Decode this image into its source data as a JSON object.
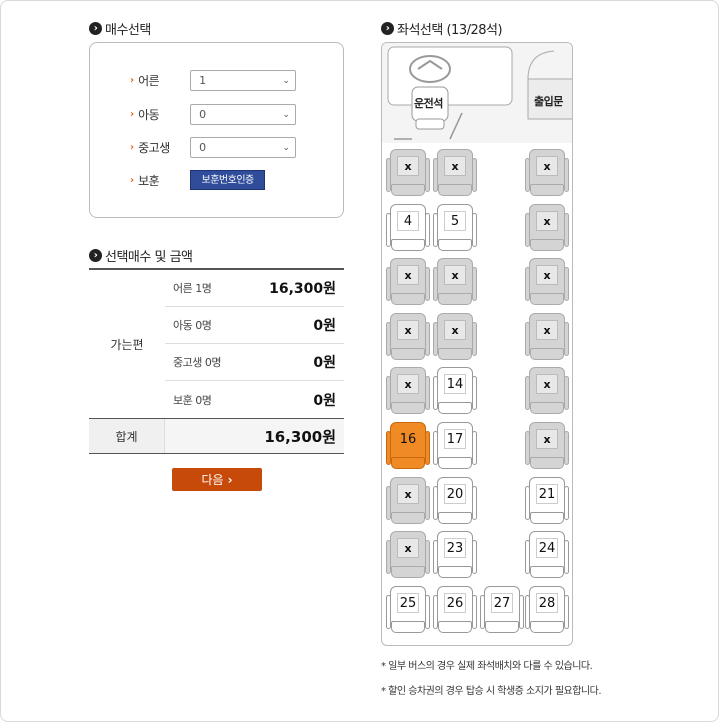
{
  "ticket_section": {
    "title": "매수선택",
    "rows": [
      {
        "label": "어른",
        "value": "1"
      },
      {
        "label": "아동",
        "value": "0"
      },
      {
        "label": "중고생",
        "value": "0"
      },
      {
        "label": "보훈"
      }
    ],
    "verify_button": "보훈번호인증"
  },
  "summary_section": {
    "title": "선택매수 및 금액",
    "direction": "가는편",
    "items": [
      {
        "label": "어른 1명",
        "amount": "16,300원"
      },
      {
        "label": "아동 0명",
        "amount": "0원"
      },
      {
        "label": "중고생 0명",
        "amount": "0원"
      },
      {
        "label": "보훈 0명",
        "amount": "0원"
      }
    ],
    "total_label": "합계",
    "total_amount": "16,300원"
  },
  "next_button": {
    "label": "다음",
    "icon": "chevron-right-icon"
  },
  "seat_section": {
    "title": "좌석선택 (13/28석)",
    "driver_label": "운전석",
    "door_label": "출입문",
    "seats": [
      {
        "label": "x",
        "status": "taken"
      },
      {
        "label": "x",
        "status": "taken"
      },
      {
        "label": "x",
        "status": "taken"
      },
      {
        "label": "4",
        "status": "available"
      },
      {
        "label": "5",
        "status": "available"
      },
      {
        "label": "x",
        "status": "taken"
      },
      {
        "label": "x",
        "status": "taken"
      },
      {
        "label": "x",
        "status": "taken"
      },
      {
        "label": "x",
        "status": "taken"
      },
      {
        "label": "x",
        "status": "taken"
      },
      {
        "label": "x",
        "status": "taken"
      },
      {
        "label": "x",
        "status": "taken"
      },
      {
        "label": "x",
        "status": "taken"
      },
      {
        "label": "14",
        "status": "available"
      },
      {
        "label": "x",
        "status": "taken"
      },
      {
        "label": "16",
        "status": "selected"
      },
      {
        "label": "17",
        "status": "available"
      },
      {
        "label": "x",
        "status": "taken"
      },
      {
        "label": "x",
        "status": "taken"
      },
      {
        "label": "20",
        "status": "available"
      },
      {
        "label": "21",
        "status": "available"
      },
      {
        "label": "x",
        "status": "taken"
      },
      {
        "label": "23",
        "status": "available"
      },
      {
        "label": "24",
        "status": "available"
      },
      {
        "label": "25",
        "status": "available"
      },
      {
        "label": "26",
        "status": "available"
      },
      {
        "label": "27",
        "status": "available"
      },
      {
        "label": "28",
        "status": "available"
      }
    ]
  },
  "notes": [
    "* 일부 버스의 경우 실제 좌석배치와 다를 수 있습니다.",
    "* 할인 승차권의 경우 탑승 시 학생증 소지가 필요합니다."
  ],
  "colors": {
    "accent": "#c84a0a",
    "selected_seat": "#f08a24",
    "verify_button": "#2f4d9a",
    "arrow": "#e8640c"
  }
}
